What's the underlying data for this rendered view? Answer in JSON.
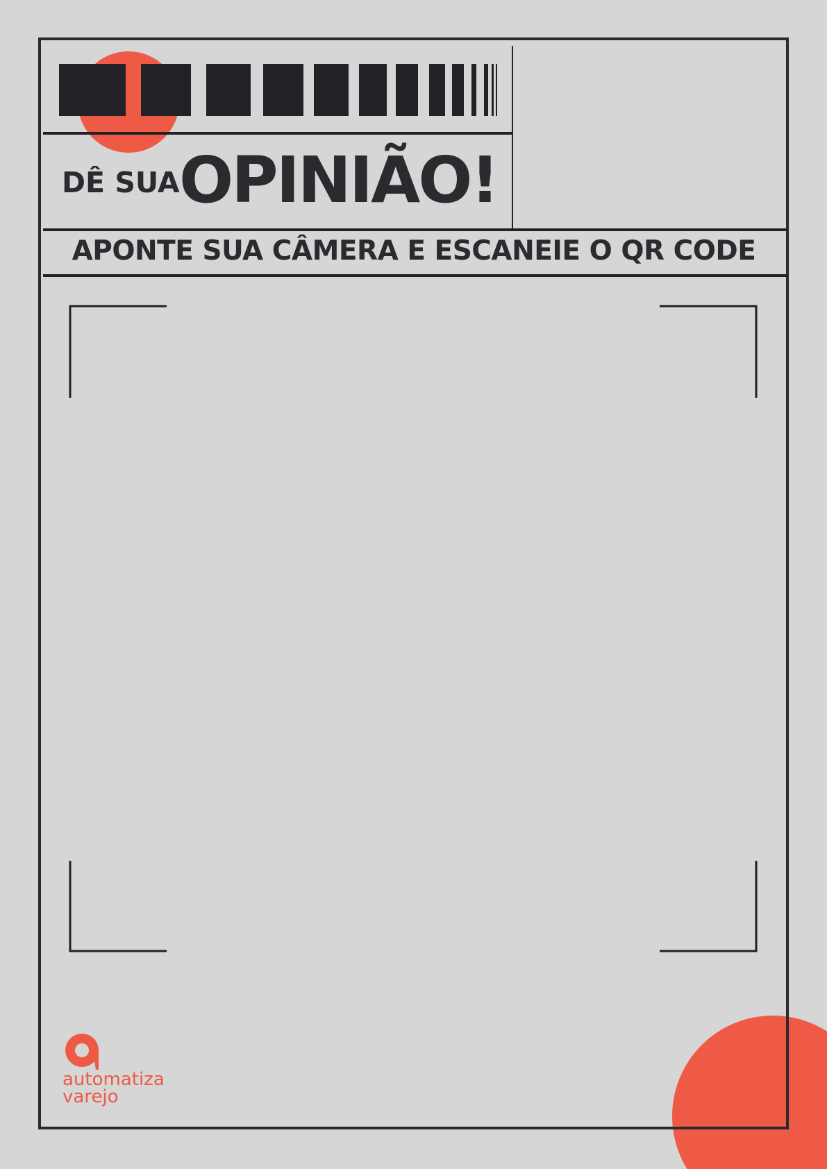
{
  "header": {
    "subtitle": "DÊ SUA",
    "title": "OPINIÃO!",
    "instruction": "APONTE SUA CÂMERA E ESCANEIE O QR CODE"
  },
  "brand": {
    "line1": "automatiza",
    "line2": "varejo",
    "color": "#EE5A45"
  },
  "colors": {
    "background": "#D6D6D6",
    "ink": "#2B2A2F",
    "accent": "#EE5A45"
  }
}
